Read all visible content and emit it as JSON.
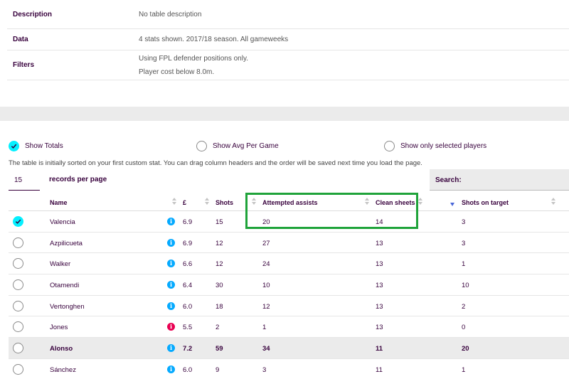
{
  "info": {
    "description_label": "Description",
    "description_value": "No table description",
    "data_label": "Data",
    "data_value": "4 stats shown. 2017/18 season. All gameweeks",
    "filters_label": "Filters",
    "filters_line1": "Using FPL defender positions only.",
    "filters_line2": "Player cost below 8.0m."
  },
  "options": {
    "show_totals": "Show Totals",
    "show_avg": "Show Avg Per Game",
    "show_selected": "Show only selected players"
  },
  "note": "The table is initially sorted on your first custom stat. You can drag column headers and the order will be saved next time you load the page.",
  "paging": {
    "value": "15",
    "label": "records per page"
  },
  "search": {
    "label": "Search:"
  },
  "columns": [
    "Name",
    "£",
    "Shots",
    "Attempted assists",
    "Clean sheets",
    "Shots on target"
  ],
  "rows": [
    {
      "name": "Valencia",
      "cost": "6.9",
      "shots": "15",
      "assists": "20",
      "clean": "14",
      "sot": "3"
    },
    {
      "name": "Azpilicueta",
      "cost": "6.9",
      "shots": "12",
      "assists": "27",
      "clean": "13",
      "sot": "3"
    },
    {
      "name": "Walker",
      "cost": "6.6",
      "shots": "12",
      "assists": "24",
      "clean": "13",
      "sot": "1"
    },
    {
      "name": "Otamendi",
      "cost": "6.4",
      "shots": "30",
      "assists": "10",
      "clean": "13",
      "sot": "10"
    },
    {
      "name": "Vertonghen",
      "cost": "6.0",
      "shots": "18",
      "assists": "12",
      "clean": "13",
      "sot": "2"
    },
    {
      "name": "Jones",
      "cost": "5.5",
      "shots": "2",
      "assists": "1",
      "clean": "13",
      "sot": "0"
    },
    {
      "name": "Alonso",
      "cost": "7.2",
      "shots": "59",
      "assists": "34",
      "clean": "11",
      "sot": "20"
    },
    {
      "name": "Sánchez",
      "cost": "6.0",
      "shots": "9",
      "assists": "3",
      "clean": "11",
      "sot": "1"
    }
  ],
  "info_icon": "i",
  "colors": {
    "accent": "#05f0ff",
    "info": "#05aaff",
    "alert": "#e90052",
    "highlight": "#1fa33a"
  }
}
